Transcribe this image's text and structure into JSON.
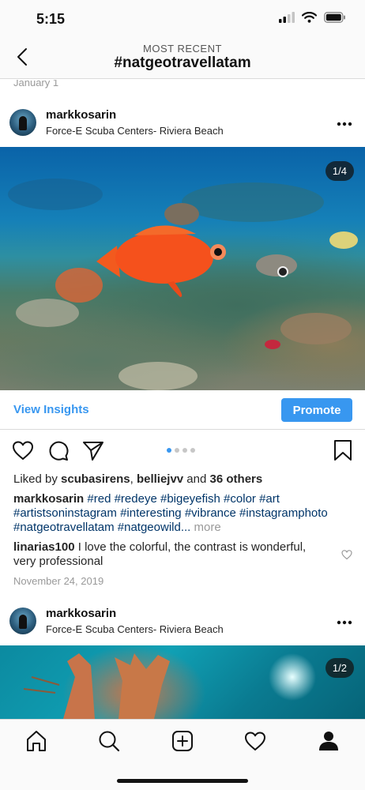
{
  "status": {
    "time": "5:15"
  },
  "header": {
    "subtitle": "MOST RECENT",
    "title": "#natgeotravellatam"
  },
  "feed": {
    "date_top": "January 1",
    "post1": {
      "username": "markkosarin",
      "location": "Force-E Scuba Centers- Riviera Beach",
      "counter": "1/4",
      "insights_label": "View Insights",
      "promote_label": "Promote",
      "likes": {
        "prefix": "Liked by ",
        "user1": "scubasirens",
        "sep": ", ",
        "user2": "belliejvv",
        "mid": " and ",
        "others": "36 others"
      },
      "caption": {
        "username": "markkosarin",
        "tags": [
          "#red",
          "#redeye",
          "#bigeyefish",
          "#color",
          "#art",
          "#artistsoninstagram",
          "#interesting",
          "#vibrance",
          "#instagramphoto",
          "#natgeotravellatam",
          "#natgeowild..."
        ],
        "more": "more"
      },
      "comment": {
        "username": "linarias100",
        "text": "I love the colorful, the contrast is wonderful, very professional"
      },
      "date": "November 24, 2019"
    },
    "post2": {
      "username": "markkosarin",
      "location": "Force-E Scuba Centers- Riviera Beach",
      "counter": "1/2"
    }
  },
  "tabs": [
    "home-icon",
    "search-icon",
    "add-post-icon",
    "activity-heart-icon",
    "profile-icon"
  ],
  "colors": {
    "accent": "#3897f0",
    "hashtag": "#003569",
    "muted": "#999999"
  }
}
